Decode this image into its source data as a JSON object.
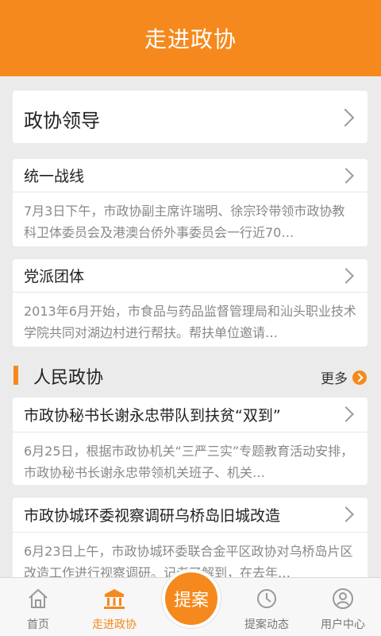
{
  "header": {
    "title": "走进政协"
  },
  "leadership": {
    "label": "政协领导"
  },
  "cards": [
    {
      "title": "统一战线",
      "snippet": "7月3日下午，市政协副主席许瑞明、徐宗玲带领市政协教科卫体委员会及港澳台侨外事委员会一行近70…"
    },
    {
      "title": "党派团体",
      "snippet": "2013年6月开始，市食品与药品监督管理局和汕头职业技术学院共同对湖边村进行帮扶。帮扶单位邀请…"
    }
  ],
  "section": {
    "title": "人民政协",
    "more": "更多"
  },
  "articles": [
    {
      "title": "市政协秘书长谢永忠带队到扶贫“双到”",
      "snippet": "6月25日，根据市政协机关“三严三实”专题教育活动安排，市政协秘书长谢永忠带领机关班子、机关…"
    },
    {
      "title": "市政协城环委视察调研乌桥岛旧城改造",
      "snippet": "6月23日上午，市政协城环委联合金平区政协对乌桥岛片区改造工作进行视察调研。记者了解到，在去年…"
    }
  ],
  "nav": {
    "items": [
      {
        "label": "首页",
        "icon": "home-icon"
      },
      {
        "label": "走进政协",
        "icon": "building-icon"
      },
      {
        "label": "提案动态",
        "icon": "clock-icon"
      },
      {
        "label": "用户中心",
        "icon": "user-icon"
      }
    ],
    "fab": "提案",
    "active_index": 1
  },
  "colors": {
    "accent": "#f5891d",
    "text": "#222222",
    "muted": "#888888"
  }
}
